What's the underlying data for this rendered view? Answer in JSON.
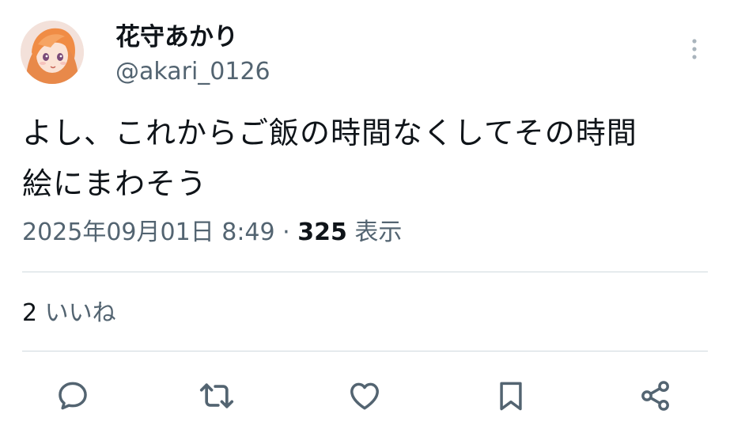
{
  "tweet": {
    "author": {
      "display_name": "花守あかり",
      "handle": "@akari_0126"
    },
    "text_lines": [
      "よし、これからご飯の時間なくしてその時間",
      "絵にまわそう"
    ],
    "timestamp": "2025年09月01日 8:49",
    "separator": "·",
    "views_count": "325",
    "views_label": "表示",
    "likes_count": "2",
    "likes_label": "いいね"
  },
  "icons": {
    "more": "more-vertical-icon",
    "reply": "reply-icon",
    "retweet": "retweet-icon",
    "like": "heart-icon",
    "bookmark": "bookmark-icon",
    "share": "share-icon"
  },
  "colors": {
    "text_primary": "#0f1419",
    "text_secondary": "#536471",
    "divider": "#cfd9de",
    "icon": "#536471"
  }
}
